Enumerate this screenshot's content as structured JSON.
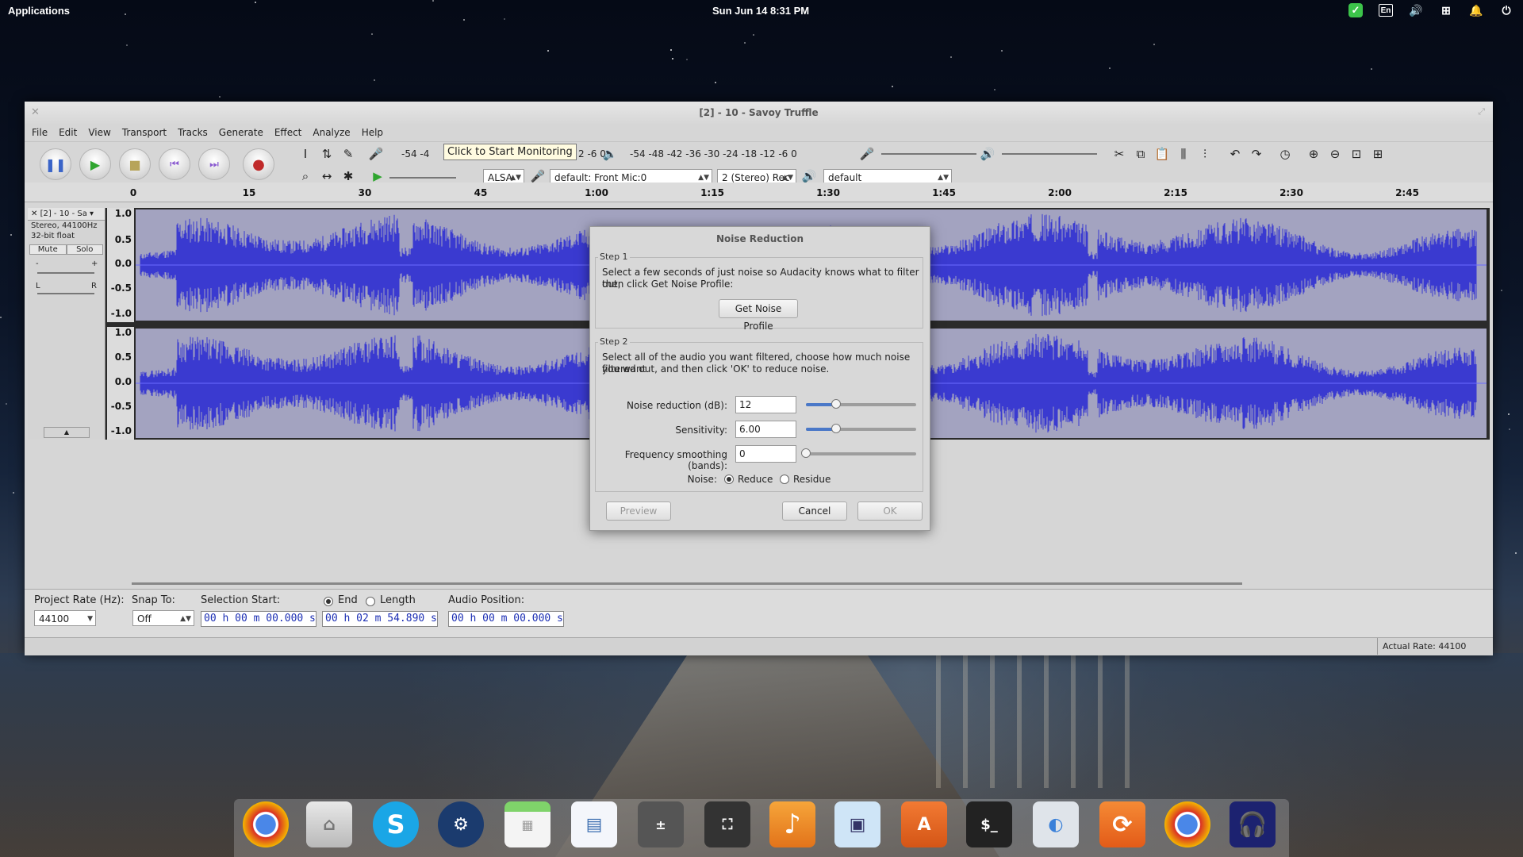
{
  "top_panel": {
    "applications": "Applications",
    "clock": "Sun Jun 14    8:31 PM",
    "keyboard_layout": "En"
  },
  "window": {
    "title": "[2] - 10 - Savoy Truffle",
    "menu": [
      "File",
      "Edit",
      "View",
      "Transport",
      "Tracks",
      "Generate",
      "Effect",
      "Analyze",
      "Help"
    ]
  },
  "toolbar": {
    "record_meter_scale": "-54 -4",
    "monitor_tip": "Click to Start Monitoring",
    "record_meter_tail": "2  -6  0",
    "playback_meter_scale": "-54  -48  -42  -36  -30  -24  -18  -12  -6  0",
    "host": "ALSA",
    "input_device": "default: Front Mic:0",
    "channels": "2 (Stereo) Rec",
    "output_device": "default"
  },
  "ruler": {
    "ticks": [
      "0",
      "15",
      "30",
      "45",
      "1:00",
      "1:15",
      "1:30",
      "1:45",
      "2:00",
      "2:15",
      "2:30",
      "2:45"
    ]
  },
  "track": {
    "name": "[2] - 10 - Sa",
    "format": "Stereo, 44100Hz",
    "depth": "32-bit float",
    "mute": "Mute",
    "solo": "Solo",
    "gain_min": "-",
    "gain_max": "+",
    "pan_left": "L",
    "pan_right": "R",
    "scale_top": [
      "1.0",
      "0.5",
      "0.0",
      "-0.5",
      "-1.0"
    ],
    "scale_bottom": [
      "1.0",
      "0.5",
      "0.0",
      "-0.5",
      "-1.0"
    ]
  },
  "dialog": {
    "title": "Noise Reduction",
    "step1_legend": "Step 1",
    "step1_text_1": "Select a few seconds of just noise so Audacity knows what to filter out,",
    "step1_text_2": "then click Get Noise Profile:",
    "get_profile": "Get Noise Profile",
    "step2_legend": "Step 2",
    "step2_text_1": "Select all of the audio you want filtered, choose how much noise you want",
    "step2_text_2": "filtered out, and then click 'OK' to reduce noise.",
    "noise_reduction_label": "Noise reduction (dB):",
    "noise_reduction_value": "12",
    "noise_reduction_level": 0.27,
    "sensitivity_label": "Sensitivity:",
    "sensitivity_value": "6.00",
    "sensitivity_level": 0.27,
    "smoothing_label": "Frequency smoothing (bands):",
    "smoothing_value": "0",
    "smoothing_level": 0.0,
    "noise_label": "Noise:",
    "reduce": "Reduce",
    "residue": "Residue",
    "selected_mode": "Reduce",
    "preview": "Preview",
    "cancel": "Cancel",
    "ok": "OK"
  },
  "selection_bar": {
    "project_rate_label": "Project Rate (Hz):",
    "project_rate": "44100",
    "snap_label": "Snap To:",
    "snap_value": "Off",
    "selection_start_label": "Selection Start:",
    "end_label": "End",
    "length_label": "Length",
    "audio_position_label": "Audio Position:",
    "selection_start": "00 h 00 m 00.000 s",
    "selection_end": "00 h 02 m 54.890 s",
    "audio_position": "00 h 00 m 00.000 s"
  },
  "status": {
    "actual_rate": "Actual Rate: 44100"
  },
  "colors": {
    "waveform": "#3a3ad0",
    "waveform_bg": "#a3a3c0",
    "slider_fill": "#4a78c8",
    "time_digits": "#1c2fb4"
  },
  "dock_items": [
    "chrome-icon",
    "files-icon",
    "skype-icon",
    "steam-icon",
    "calendar-icon",
    "document-viewer-icon",
    "calculator-icon",
    "screenshot-icon",
    "music-icon",
    "photos-icon",
    "app-center-icon",
    "terminal-icon",
    "switchboard-icon",
    "software-updater-icon",
    "chrome-icon",
    "headphones-icon"
  ]
}
